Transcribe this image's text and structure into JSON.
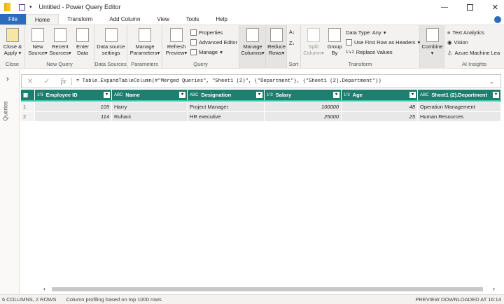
{
  "title": "Untitled - Power Query Editor",
  "tabs": [
    "File",
    "Home",
    "Transform",
    "Add Column",
    "View",
    "Tools",
    "Help"
  ],
  "ribbon": {
    "close": {
      "btn": "Close &",
      "btn2": "Apply",
      "label": "Close"
    },
    "new_query": {
      "new1": "New",
      "new2": "Source",
      "recent1": "Recent",
      "recent2": "Sources",
      "enter1": "Enter",
      "enter2": "Data",
      "label": "New Query"
    },
    "data_sources": {
      "b1": "Data source",
      "b2": "settings",
      "label": "Data Sources"
    },
    "parameters": {
      "b1": "Manage",
      "b2": "Parameters",
      "label": "Parameters"
    },
    "query": {
      "r1": "Refresh",
      "r2": "Preview",
      "properties": "Properties",
      "advanced": "Advanced Editor",
      "manage": "Manage",
      "label": "Query"
    },
    "manage_columns": {
      "b1": "Manage",
      "b2": "Columns"
    },
    "reduce_rows": {
      "b1": "Reduce",
      "b2": "Rows"
    },
    "sort": {
      "label": "Sort"
    },
    "transform": {
      "split1": "Split",
      "split2": "Column",
      "group1": "Group",
      "group2": "By",
      "datatype": "Data Type: Any",
      "firstrow": "Use First Row as Headers",
      "replace": "Replace Values",
      "label": "Transform"
    },
    "combine": {
      "b1": "Combine"
    },
    "ai": {
      "text": "Text Analytics",
      "vision": "Vision",
      "azure": "Azure Machine Lea",
      "label": "AI Insights"
    }
  },
  "queries_label": "Queries",
  "formula": "= Table.ExpandTableColumn(#\"Merged Queries\", \"Sheet1 (2)\", {\"Department\"}, {\"Sheet1 (2).Department\"})",
  "columns": [
    {
      "type": "1²3",
      "name": "Employee ID"
    },
    {
      "type": "ABC",
      "name": "Name"
    },
    {
      "type": "ABC",
      "name": "Designation"
    },
    {
      "type": "1²3",
      "name": "Salary"
    },
    {
      "type": "1²3",
      "name": "Age"
    },
    {
      "type": "ABC",
      "name": "Sheet1 (2).Department"
    }
  ],
  "rows": [
    [
      "1",
      "109",
      "Harry",
      "Project Manager",
      "100000",
      "48",
      "Operation Management"
    ],
    [
      "2",
      "114",
      "Ruhani",
      "HR executive",
      "25000",
      "25",
      "Human Resources"
    ]
  ],
  "status": {
    "left": "6 COLUMNS, 2 ROWS",
    "profiling": "Column profiling based on top 1000 rows",
    "right": "PREVIEW DOWNLOADED AT 16:14"
  }
}
